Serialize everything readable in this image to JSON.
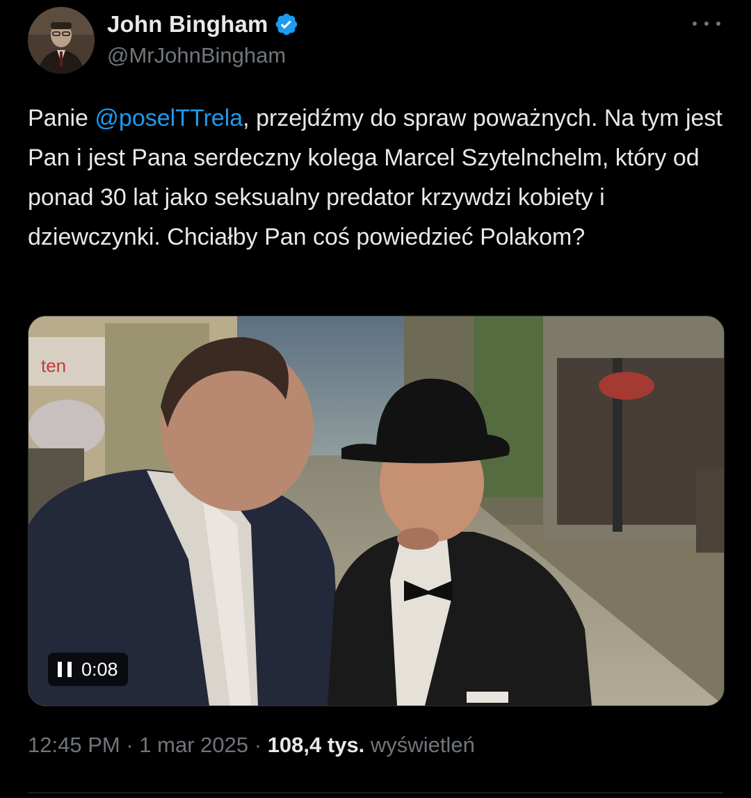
{
  "author": {
    "display_name": "John Bingham",
    "handle": "@MrJohnBingham",
    "verified": true,
    "verified_color": "#1d9bf0"
  },
  "tweet": {
    "text_before_mention": "Panie ",
    "mention": "@poselTTrela",
    "text_after_mention": ", przejdźmy do spraw poważnych. Na tym jest Pan i jest Pana serdeczny kolega Marcel Szytelnchelm, który od ponad 30 lat jako seksualny predator krzywdzi kobiety i dziewczynki. Chciałby Pan coś powiedzieć Polakom?"
  },
  "video": {
    "state": "playing",
    "elapsed": "0:08",
    "control_icon": "pause-icon"
  },
  "meta": {
    "time": "12:45 PM",
    "separator": "·",
    "date": "1 mar 2025",
    "views_count": "108,4 tys.",
    "views_label": "wyświetleń"
  },
  "icons": {
    "more": "more-icon",
    "verified": "verified-badge-icon"
  },
  "colors": {
    "background": "#000000",
    "text_primary": "#e7e9ea",
    "text_secondary": "#71767b",
    "link": "#1d9bf0"
  }
}
